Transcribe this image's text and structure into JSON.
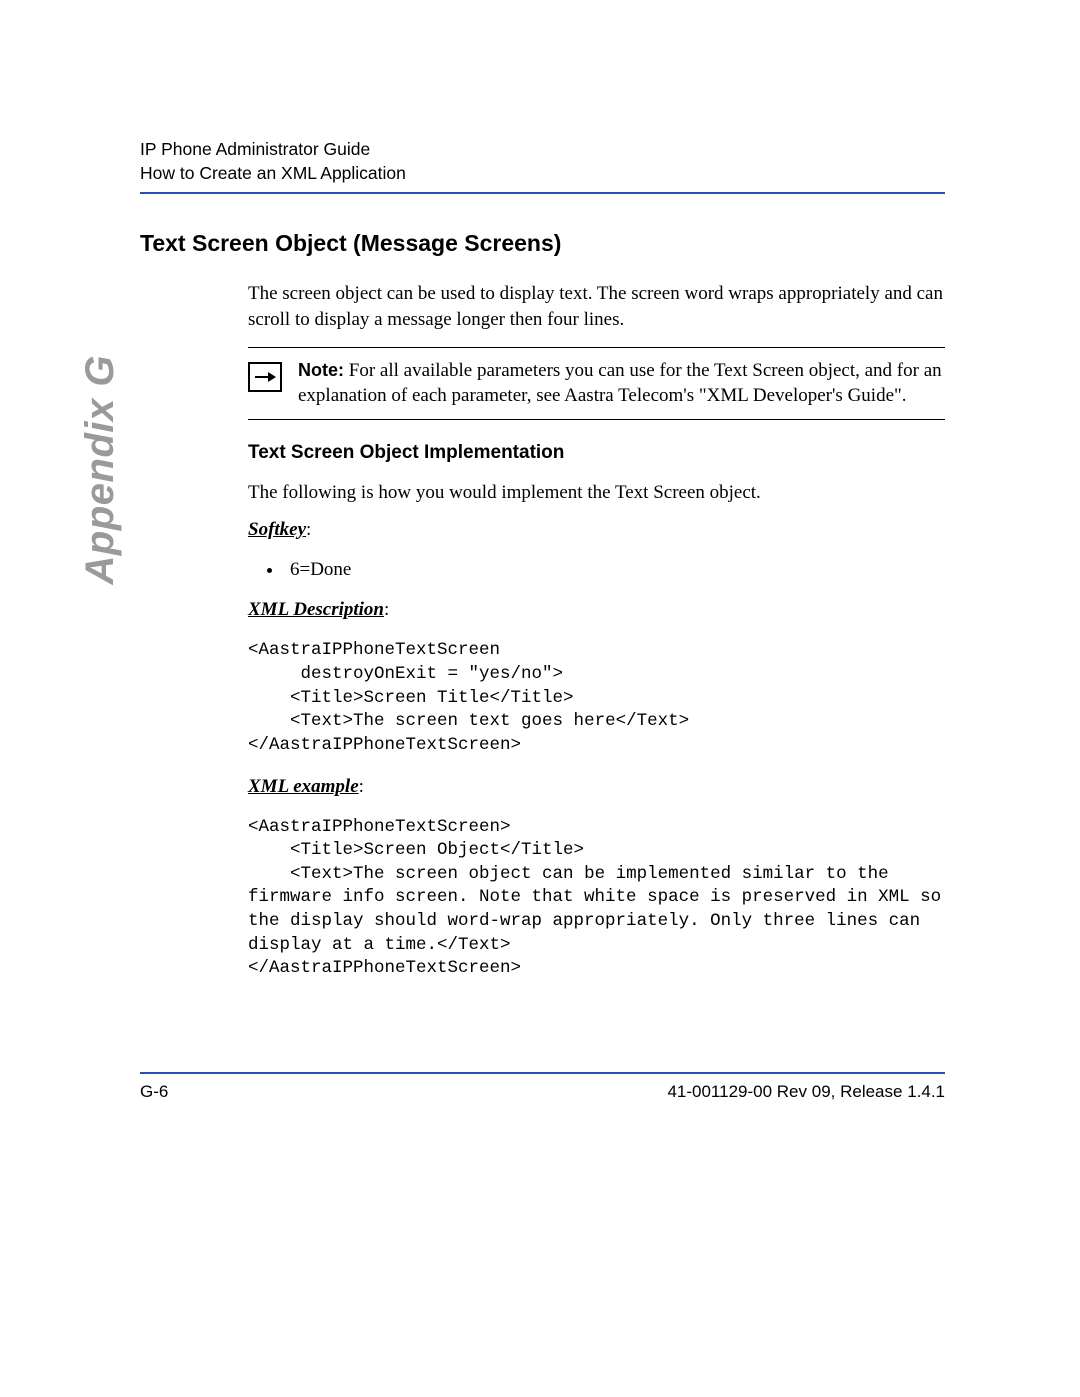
{
  "header": {
    "line1": "IP Phone Administrator Guide",
    "line2": "How to Create an XML Application"
  },
  "side_tab": "Appendix G",
  "section_title": "Text Screen Object (Message Screens)",
  "intro_para": "The screen object can be used to display text. The screen word wraps appropriately and can scroll to display a message longer then four lines.",
  "note": {
    "label": "Note:",
    "text": " For all available parameters you can use for the Text Screen object, and for an explanation of each parameter, see Aastra Telecom's \"XML Developer's Guide\"."
  },
  "subheading": "Text Screen Object Implementation",
  "impl_intro": "The following is how you would implement the Text Screen object.",
  "softkey": {
    "label": "Softkey",
    "colon": ":",
    "items": [
      "6=Done"
    ]
  },
  "xml_desc": {
    "label": "XML Description",
    "colon": ":",
    "code": "<AastraIPPhoneTextScreen\n     destroyOnExit = \"yes/no\">\n    <Title>Screen Title</Title>\n    <Text>The screen text goes here</Text>\n</AastraIPPhoneTextScreen>"
  },
  "xml_ex": {
    "label": "XML example",
    "colon": ":",
    "code": "<AastraIPPhoneTextScreen>\n    <Title>Screen Object</Title>\n    <Text>The screen object can be implemented similar to the firmware info screen. Note that white space is preserved in XML so the display should word-wrap appropriately. Only three lines can display at a time.</Text>\n</AastraIPPhoneTextScreen>"
  },
  "footer": {
    "page": "G-6",
    "doc": "41-001129-00 Rev 09, Release 1.4.1"
  }
}
